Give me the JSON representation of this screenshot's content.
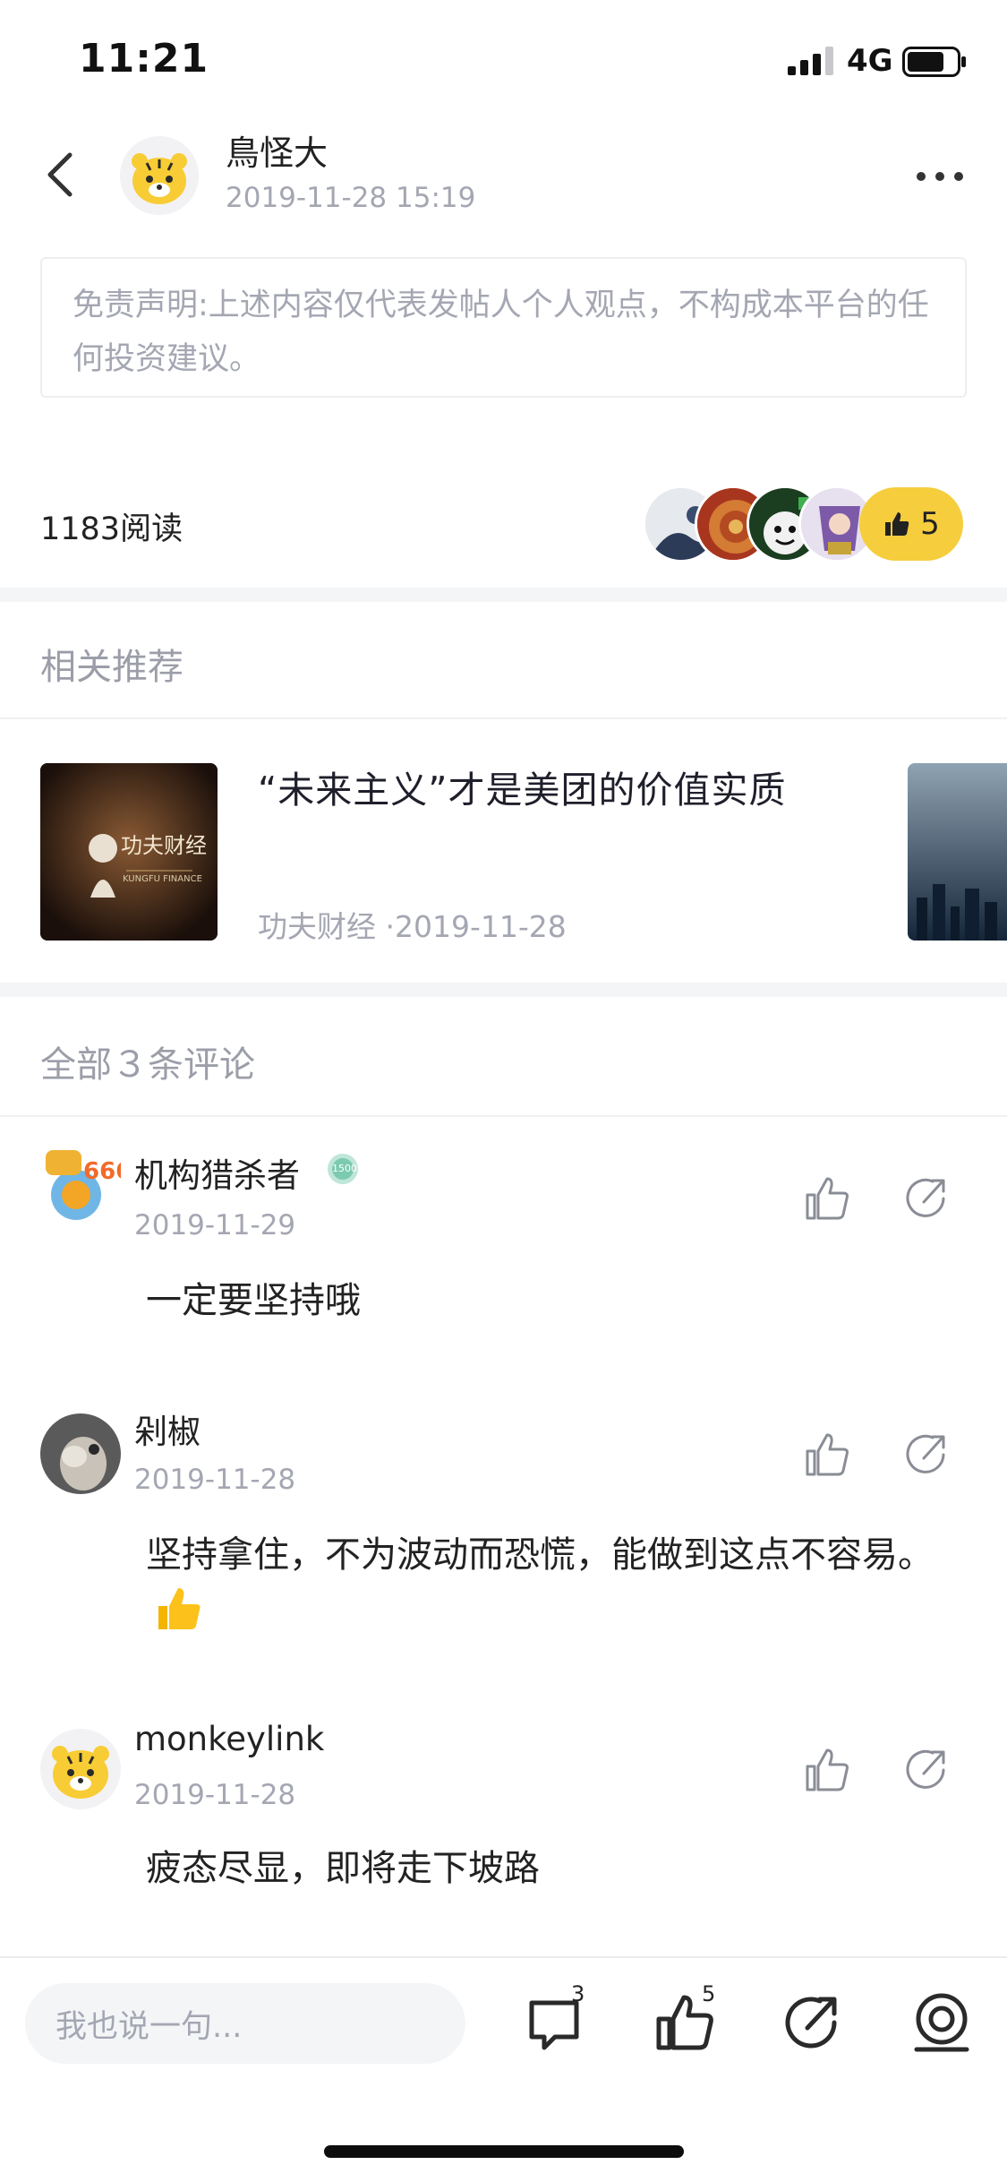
{
  "status_bar": {
    "time": "11:21",
    "network": "4G"
  },
  "post": {
    "author": "鳥怪大",
    "timestamp": "2019-11-28 15:19",
    "disclaimer": "免责声明:上述内容仅代表发帖人个人观点，不构成本平台的任何投资建议。",
    "read_count": "1183阅读",
    "like_count": "5"
  },
  "recommend": {
    "section_title": "相关推荐",
    "items": [
      {
        "title": "“未来主义”才是美团的价值实质",
        "source": "功夫财经",
        "date": "·2019-11-28",
        "thumb_text": "功夫财经",
        "thumb_sub": "KUNGFU FINANCE"
      }
    ]
  },
  "comments": {
    "section_title": "全部３条评论",
    "items": [
      {
        "name": "机构猎杀者",
        "date": "2019-11-29",
        "text": "一定要坚持哦",
        "badge": "1500"
      },
      {
        "name": "剁椒",
        "date": "2019-11-28",
        "text": "坚持拿住，不为波动而恐慌，能做到这点不容易。"
      },
      {
        "name": "monkeylink",
        "date": "2019-11-28",
        "text": "疲态尽显，即将走下坡路"
      }
    ]
  },
  "bottom_bar": {
    "input_placeholder": "我也说一句...",
    "comment_count": "3",
    "like_count": "5"
  },
  "colors": {
    "accent_yellow": "#f6cd3d",
    "muted_text": "#a4a7b2",
    "section_title": "#9b9ea8",
    "divider": "#f4f5f7"
  },
  "icons": [
    "back-icon",
    "more-icon",
    "thumbs-up-icon",
    "share-icon",
    "comment-icon",
    "reward-icon",
    "signal-icon",
    "battery-icon"
  ]
}
